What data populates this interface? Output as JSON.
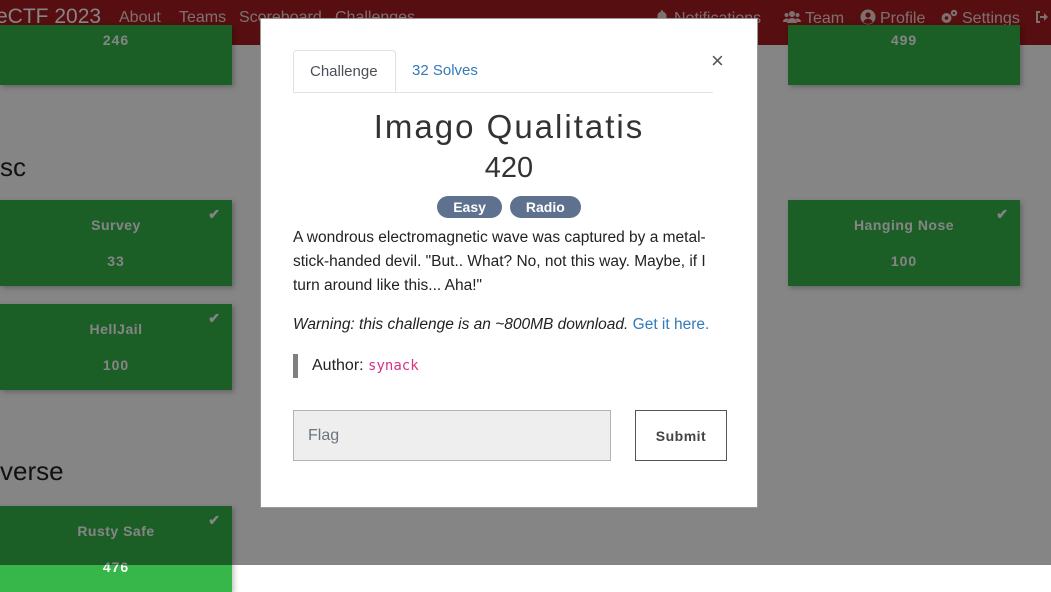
{
  "navbar": {
    "brand": "eCTF 2023",
    "links": [
      "About",
      "Teams",
      "Scoreboard",
      "Challenges"
    ],
    "right": [
      {
        "label": "Notifications",
        "icon": "bell-icon"
      },
      {
        "label": "Team",
        "icon": "users-icon"
      },
      {
        "label": "Profile",
        "icon": "user-circle-icon"
      },
      {
        "label": "Settings",
        "icon": "cogs-icon"
      },
      {
        "label": "",
        "icon": "logout-icon"
      }
    ]
  },
  "board": {
    "top_values": [
      "246",
      "499"
    ],
    "sections": [
      {
        "title": "sc",
        "cards": [
          {
            "name": "Survey",
            "value": "33"
          },
          {
            "name": "Hanging Nose",
            "value": "100"
          },
          {
            "name": "HellJail",
            "value": "100"
          }
        ]
      },
      {
        "title": "verse",
        "cards": [
          {
            "name": "Rusty Safe",
            "value": "476"
          }
        ]
      }
    ],
    "solved_color": "#37b64a"
  },
  "modal": {
    "tabs": [
      {
        "label": "Challenge",
        "active": true
      },
      {
        "label": "32 Solves",
        "active": false
      }
    ],
    "close": "×",
    "title": "Imago Qualitatis",
    "value": "420",
    "tags": [
      "Easy",
      "Radio"
    ],
    "description": "A wondrous electromagnetic wave was captured by a metal-stick-handed devil. \"But.. What? No, not this way. Maybe, if I turn around like this... Aha!\"",
    "warning": "Warning: this challenge is an ~800MB download.",
    "download_link": "Get it here.",
    "author_label": "Author:",
    "author": "synack",
    "flag_placeholder": "Flag",
    "submit_label": "Submit",
    "colors": {
      "tag": "#5e7290",
      "link": "#337ab7",
      "author": "#d63384",
      "navbar": "#a61b1f"
    }
  }
}
